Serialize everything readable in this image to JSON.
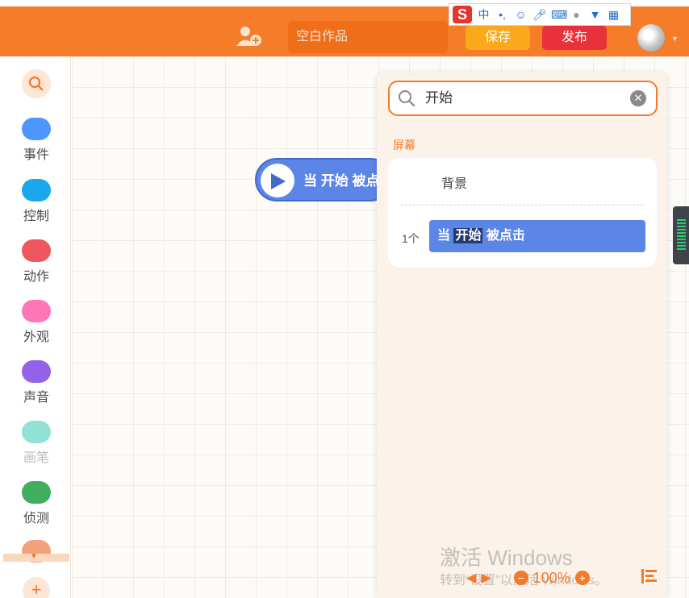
{
  "header": {
    "title_placeholder": "空白作品",
    "save_label": "保存",
    "publish_label": "发布",
    "accent": "#f57c28"
  },
  "ime": {
    "logo": "S",
    "mode": "中",
    "punct": "•,"
  },
  "sidebar": {
    "categories": [
      {
        "label": "事件",
        "color": "#4c97ff"
      },
      {
        "label": "控制",
        "color": "#1aa7ec"
      },
      {
        "label": "动作",
        "color": "#f0565d"
      },
      {
        "label": "外观",
        "color": "#ff77b8"
      },
      {
        "label": "声音",
        "color": "#9462e8"
      },
      {
        "label": "画笔",
        "color": "#91e2d4"
      },
      {
        "label": "侦测",
        "color": "#3fae5f"
      }
    ]
  },
  "canvas": {
    "event_block_text": "当 开始 被点击"
  },
  "search_panel": {
    "query": "开始",
    "section": "屏幕",
    "result_target": "背景",
    "result_count": "1个",
    "result_block_pre": "当 ",
    "result_block_hl": "开始",
    "result_block_post": " 被点击"
  },
  "footer": {
    "watermark_line1": "激活 Windows",
    "watermark_line2": "转到“设置”以激活 Windows。",
    "zoom": "100%"
  }
}
